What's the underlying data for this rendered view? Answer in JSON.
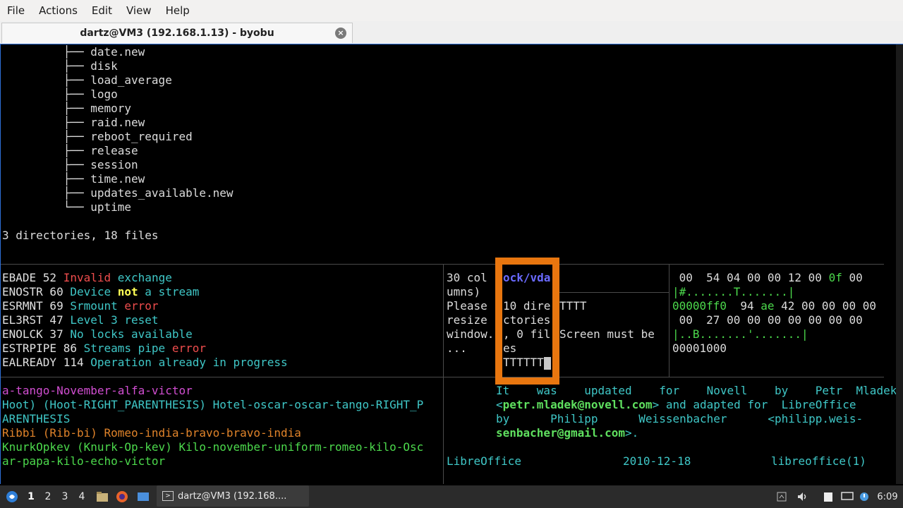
{
  "menu": [
    "File",
    "Actions",
    "Edit",
    "View",
    "Help"
  ],
  "tab": {
    "title": "dartz@VM3 (192.168.1.13) - byobu",
    "close_icon": "×"
  },
  "tree": {
    "items": [
      "date.new",
      "disk",
      "load_average",
      "logo",
      "memory",
      "raid.new",
      "reboot_required",
      "release",
      "session",
      "time.new",
      "updates_available.new",
      "uptime"
    ],
    "summary": "3 directories, 18 files"
  },
  "pane_errors": [
    {
      "code": "EBADE",
      "num": "52",
      "parts": [
        [
          "red",
          "Invalid"
        ],
        [
          "cyan",
          " exchange"
        ]
      ]
    },
    {
      "code": "ENOSTR",
      "num": "60",
      "parts": [
        [
          "cyan",
          "Device "
        ],
        [
          "yellow",
          "not"
        ],
        [
          "cyan",
          " a stream"
        ]
      ]
    },
    {
      "code": "ESRMNT",
      "num": "69",
      "parts": [
        [
          "cyan",
          "Srmount "
        ],
        [
          "red",
          "error"
        ]
      ]
    },
    {
      "code": "EL3RST",
      "num": "47",
      "parts": [
        [
          "cyan",
          "Level 3 reset"
        ]
      ]
    },
    {
      "code": "ENOLCK",
      "num": "37",
      "parts": [
        [
          "cyan",
          "No locks available"
        ]
      ]
    },
    {
      "code": "ESTRPIPE",
      "num": "86",
      "parts": [
        [
          "cyan",
          "Streams pipe "
        ],
        [
          "red",
          "error"
        ]
      ]
    },
    {
      "code": "EALREADY",
      "num": "114",
      "parts": [
        [
          "cyan",
          "Operation already in progress"
        ]
      ]
    }
  ],
  "pane_small": [
    "30 col",
    "umns)",
    "Please",
    "resize",
    "window.",
    "..."
  ],
  "pane_tiny": {
    "header": "ock/vda",
    "lines": [
      "10 dire",
      "ctories",
      ", 0 fil",
      "es"
    ],
    "prompt": "TTTTTT"
  },
  "pane_mid": [
    "TTTT",
    "",
    "Screen must be"
  ],
  "pane_hex": [
    {
      "text": " 00  54 04 00 00 12 00 ",
      "green": "0f",
      "after": " 00"
    },
    {
      "text": "",
      "green": "|#.......T.......|",
      "after": ""
    },
    {
      "text": "",
      "green": "00000ff0",
      "after": "  94 ",
      "green2": "ae",
      "after2": " 42 00 00 00 00"
    },
    {
      "text": " 00  27 00 00 00 00 00 00 00",
      "green": "",
      "after": ""
    },
    {
      "text": "",
      "green": "|..B.......'.......|",
      "after": ""
    },
    {
      "text": "00001000",
      "green": "",
      "after": ""
    }
  ],
  "pane_words": [
    {
      "color": "magenta",
      "text": "a-tango-November-alfa-victor"
    },
    {
      "color": "cyan",
      "text": "Hoot) (Hoot-RIGHT_PARENTHESIS) Hotel-oscar-oscar-tango-RIGHT_P"
    },
    {
      "color": "cyan",
      "text": "ARENTHESIS"
    },
    {
      "color": "orange",
      "text": "Ribbi (Rib-bi) Romeo-india-bravo-bravo-india"
    },
    {
      "color": "green",
      "text": "KnurkOpkev (Knurk-Op-kev) Kilo-november-uniform-romeo-kilo-Osc"
    },
    {
      "color": "green",
      "text": "ar-papa-kilo-echo-victor"
    }
  ],
  "pane_man": {
    "line1": "It    was    updated    for    Novell    by    Petr  Mladek",
    "email1": "petr.mladek@novell.com",
    "line2_rest": " and adapted for  LibreOffice",
    "line3": "by      Philipp      Weissenbacher      <philipp.weis-",
    "email2_end": "senbacher@gmail.com",
    "line4_rest": ">.",
    "footer_left": "LibreOffice",
    "footer_mid": "2010-12-18",
    "footer_right": "libreoffice(1)"
  },
  "taskbar": {
    "workspaces": [
      "1",
      "2",
      "3",
      "4"
    ],
    "task_label": "dartz@VM3 (192.168....",
    "clock": "6:09"
  }
}
